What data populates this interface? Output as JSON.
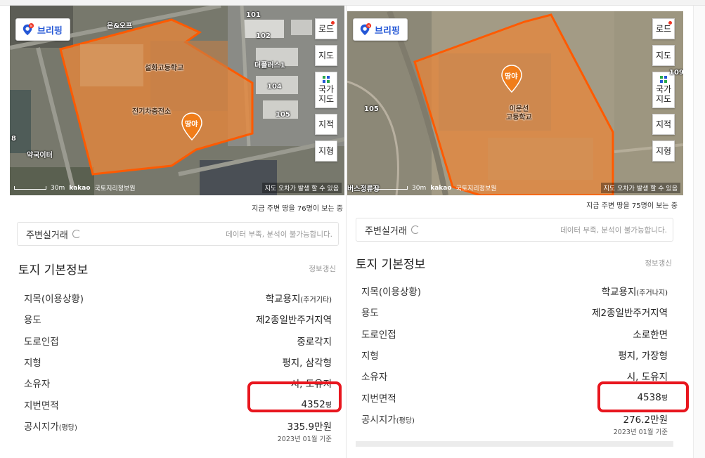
{
  "panels": [
    {
      "map": {
        "brand_label": "브리핑",
        "controls": [
          "로드",
          "지도",
          "국가\n지도",
          "지적",
          "지형"
        ],
        "building_labels": {
          "school": "설화고등학교",
          "substation": "전기차충전소",
          "shop": "온&오프",
          "apt": "더플러스1",
          "pharmacy": "약국이터",
          "n101": "101",
          "n102": "102",
          "n104": "104",
          "n105": "105",
          "n8": "8"
        },
        "pin_label": "땅야",
        "scale_label": "30m",
        "kakao_label": "kakao",
        "copyright": "국토지리정보원",
        "note": "지도 오차가 발생 할 수 있음"
      },
      "viewers": "지금 주변 땅을 76명이 보는 중",
      "nearby": {
        "title": "주변실거래",
        "message": "데이터 부족, 분석이 불가능합니다."
      },
      "section": {
        "title": "토지 기본정보",
        "update": "정보갱신"
      },
      "rows": [
        {
          "key": "지목(이용상황)",
          "value": "학교용지",
          "value_sub": "(주거기타)"
        },
        {
          "key": "용도",
          "value": "제2종일반주거지역"
        },
        {
          "key": "도로인접",
          "value": "중로각지"
        },
        {
          "key": "지형",
          "value": "평지, 삼각형"
        },
        {
          "key": "소유자",
          "value": "시, 도유지"
        },
        {
          "key": "지번면적",
          "value": "4352",
          "value_sub": "평"
        },
        {
          "key": "공시지가",
          "key_sub": "(평당)",
          "value": "335.9만원"
        }
      ],
      "asof": "2023년 01월 기준"
    },
    {
      "map": {
        "brand_label": "브리핑",
        "controls": [
          "로드",
          "지도",
          "국가\n지도",
          "지적",
          "지형"
        ],
        "building_labels": {
          "school": "이운선\n고등학교",
          "n105": "105",
          "n109": "109",
          "bus": "버스정류장"
        },
        "pin_label": "땅야",
        "scale_label": "30m",
        "kakao_label": "kakao",
        "copyright": "국토지리정보원",
        "note": "지도 오차가 발생 할 수 있음"
      },
      "viewers": "지금 주변 땅을 75명이 보는 중",
      "nearby": {
        "title": "주변실거래",
        "message": "데이터 부족, 분석이 불가능합니다."
      },
      "section": {
        "title": "토지 기본정보",
        "update": "정보갱신"
      },
      "rows": [
        {
          "key": "지목(이용상황)",
          "value": "학교용지",
          "value_sub": "(주거나지)"
        },
        {
          "key": "용도",
          "value": "제2종일반주거지역"
        },
        {
          "key": "도로인접",
          "value": "소로한면"
        },
        {
          "key": "지형",
          "value": "평지, 가장형"
        },
        {
          "key": "소유자",
          "value": "시, 도유지"
        },
        {
          "key": "지번면적",
          "value": "4538",
          "value_sub": "평"
        },
        {
          "key": "공시지가",
          "key_sub": "(평당)",
          "value": "276.2만원"
        }
      ],
      "asof": "2023년 01월 기준"
    }
  ],
  "colors": {
    "parcel_fill": "#e8863a",
    "parcel_stroke": "#ff5a00",
    "highlight": "#e8161e",
    "pin": "#f07d1a",
    "brand": "#2457d6"
  }
}
